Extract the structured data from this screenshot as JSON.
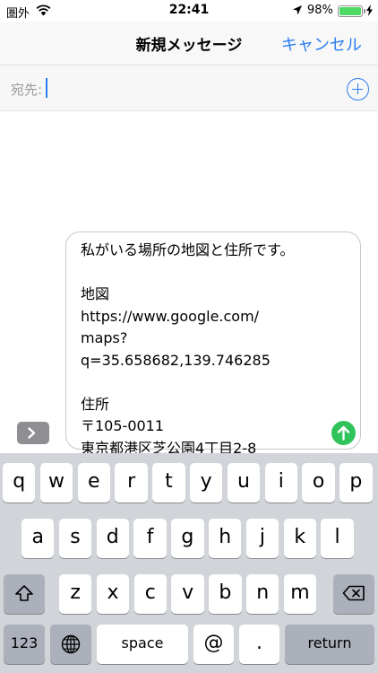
{
  "status_bar": {
    "carrier": "圏外",
    "time": "22:41",
    "battery": "98%",
    "battery_level": 0.98,
    "icons": [
      "wifi-icon",
      "location-arrow-icon",
      "battery-icon",
      "charging-icon"
    ]
  },
  "nav": {
    "title": "新規メッセージ",
    "cancel_label": "キャンセル"
  },
  "to_field": {
    "label": "宛先:",
    "value": "",
    "add_icon": "add-contact-icon"
  },
  "compose": {
    "message": "私がいる場所の地図と住所です。\n\n地図\nhttps://www.google.com/\nmaps?\nq=35.658682,139.746285\n\n住所\n〒105-0011\n東京都港区芝公園4丁目2-8",
    "apps_icon": "chevron-right-icon",
    "send_icon": "send-arrow-icon"
  },
  "keyboard": {
    "row1": [
      "q",
      "w",
      "e",
      "r",
      "t",
      "y",
      "u",
      "i",
      "o",
      "p"
    ],
    "row2": [
      "a",
      "s",
      "d",
      "f",
      "g",
      "h",
      "j",
      "k",
      "l"
    ],
    "row3": [
      "z",
      "x",
      "c",
      "v",
      "b",
      "n",
      "m"
    ],
    "numbers_label": "123",
    "space_label": "space",
    "at_label": "@",
    "period_label": ".",
    "return_label": "return",
    "shift_icon": "shift-icon",
    "delete_icon": "backspace-icon",
    "globe_icon": "globe-icon"
  },
  "colors": {
    "accent": "#2c7df0",
    "send": "#30c35a",
    "battery": "#4cd964"
  }
}
